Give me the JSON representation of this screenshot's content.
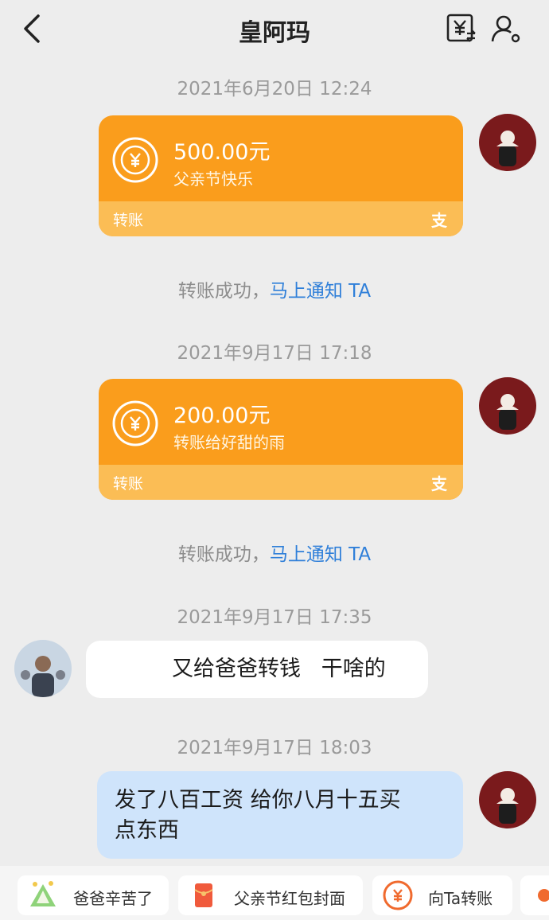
{
  "header": {
    "title": "皇阿玛",
    "back_icon": "chevron-left-icon",
    "transfer_icon": "yuan-transfer-icon",
    "profile_icon": "user-settings-icon"
  },
  "messages": {
    "ts1": "2021年6月20日 12:24",
    "card1": {
      "amount": "500.00元",
      "note": "父亲节快乐",
      "label": "转账",
      "brand_mark": "支"
    },
    "sys1": {
      "text": "转账成功，",
      "link": "马上通知 TA"
    },
    "ts2": "2021年9月17日 17:18",
    "card2": {
      "amount": "200.00元",
      "note": "转账给好甜的雨",
      "label": "转账",
      "brand_mark": "支"
    },
    "sys2": {
      "text": "转账成功，",
      "link": "马上通知 TA"
    },
    "ts3": "2021年9月17日 17:35",
    "incoming": {
      "text": "又给爸爸转钱   干啥的"
    },
    "ts4": "2021年9月17日 18:03",
    "outgoing": {
      "line1": "发了八百工资 给你八月十五买",
      "line2": "点东西"
    }
  },
  "quick_actions": {
    "chip1": "爸爸辛苦了",
    "chip2": "父亲节红包封面",
    "chip3": "向Ta转账"
  },
  "colors": {
    "card_orange": "#fa9d1c",
    "card_light": "#fbbd55",
    "link_blue": "#2f7fd9",
    "out_bubble": "#cfe4fb"
  }
}
